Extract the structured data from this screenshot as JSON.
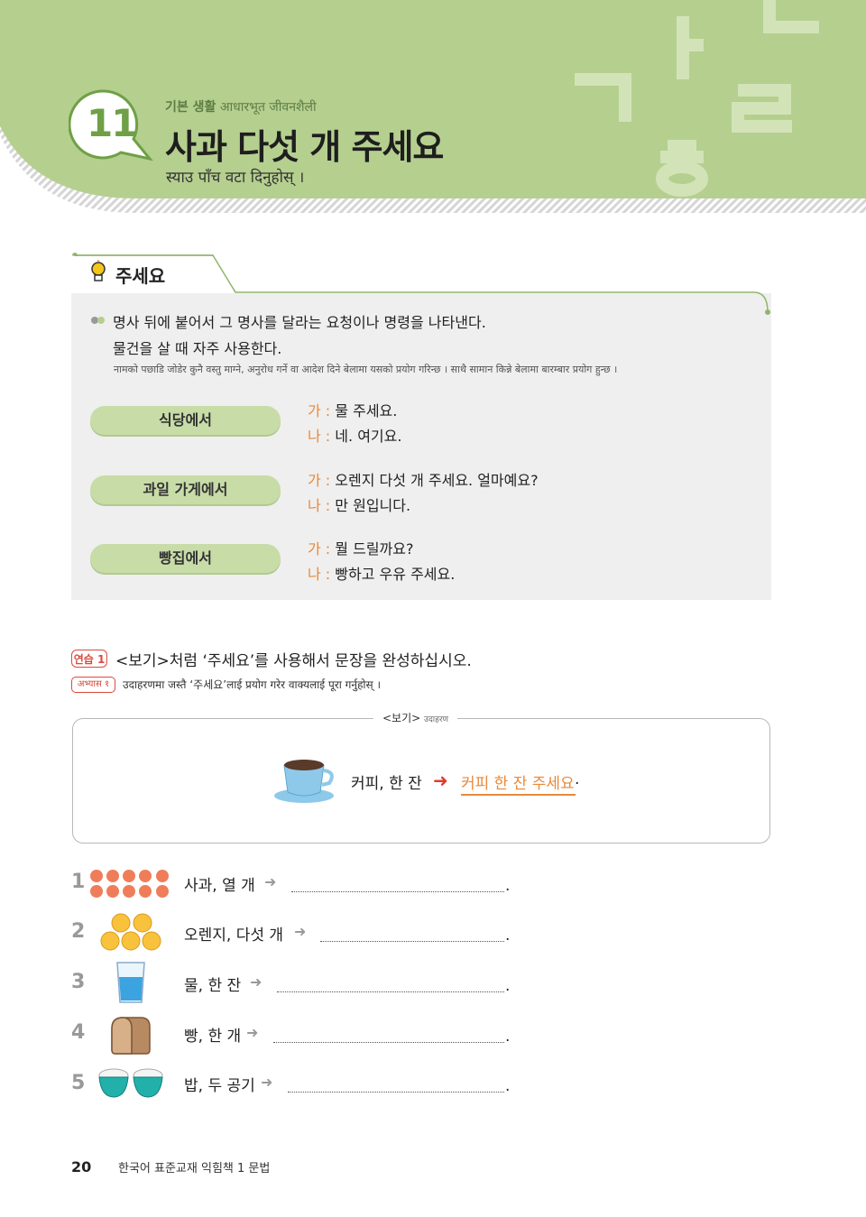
{
  "header": {
    "lesson_number": "11",
    "category_ko": "기본 생활",
    "category_ne": "आधारभूत जीवनशैली",
    "title": "사과 다섯 개 주세요",
    "subtitle": "स्याउ पाँच वटा दिनुहोस् ।",
    "decor_letters": [
      "ㄱ",
      "ㅏ",
      "ㄷ",
      "ㄹ",
      "ㅎ"
    ]
  },
  "grammar": {
    "tab_label": "주세요",
    "desc_line1": "명사 뒤에 붙어서 그 명사를 달라는 요청이나 명령을 나타낸다.",
    "desc_line2": "물건을 살 때 자주 사용한다.",
    "desc_ne": "नामको पछाडि जोडेर कुनै वस्तु माग्ने, अनुरोध गर्ने वा आदेश दिने बेलामा यसको प्रयोग गरिन्छ । साथै सामान किन्ने बेलामा बारम्बार प्रयोग हुन्छ ।",
    "situations": [
      {
        "place": "식당에서",
        "a_speaker": "가 :",
        "a_line": "물 주세요.",
        "b_speaker": "나 :",
        "b_line": "네. 여기요."
      },
      {
        "place": "과일 가게에서",
        "a_speaker": "가 :",
        "a_line": "오렌지 다섯 개 주세요. 얼마예요?",
        "b_speaker": "나 :",
        "b_line": "만 원입니다."
      },
      {
        "place": "빵집에서",
        "a_speaker": "가 :",
        "a_line": "뭘 드릴까요?",
        "b_speaker": "나 :",
        "b_line": "빵하고 우유 주세요."
      }
    ]
  },
  "exercise": {
    "badge_ko": "연습 1",
    "badge_ne": "अभ्यास १",
    "instruction_ko": "<보기>처럼 ‘주세요’를 사용해서 문장을 완성하십시오.",
    "instruction_ne": "उदाहरणमा जस्तै ‘주세요’लाई प्रयोग गरेर वाक्यलाई पूरा गर्नुहोस् ।",
    "example_label": "<보기>",
    "example_label_ne": "उदाहरण",
    "example_cue": "커피, 한 잔",
    "example_answer": "커피 한 잔 주세요",
    "example_period": ".",
    "items": [
      {
        "num": "1",
        "cue": "사과, 열 개",
        "icon": "apples-icon",
        "end": "."
      },
      {
        "num": "2",
        "cue": "오렌지, 다섯 개",
        "icon": "oranges-icon",
        "end": "."
      },
      {
        "num": "3",
        "cue": "물, 한 잔",
        "icon": "water-glass-icon",
        "end": "."
      },
      {
        "num": "4",
        "cue": "빵, 한 개",
        "icon": "bread-icon",
        "end": "."
      },
      {
        "num": "5",
        "cue": "밥, 두 공기",
        "icon": "rice-bowls-icon",
        "end": "."
      }
    ]
  },
  "footer": {
    "page_number": "20",
    "book_title": "한국어 표준교재 익힘책 1 문법"
  },
  "colors": {
    "header_green": "#b5cf8f",
    "accent_orange": "#e8893a",
    "accent_red": "#d94a3d",
    "pill_green": "#c8dca8"
  }
}
